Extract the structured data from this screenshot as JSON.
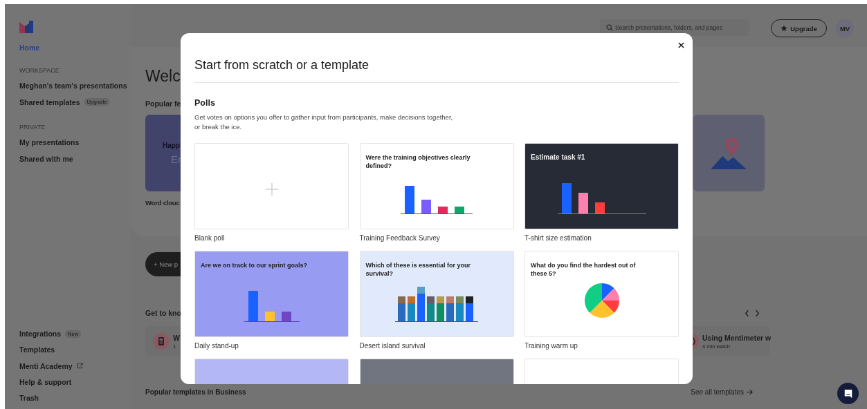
{
  "sidebar": {
    "nav": [
      {
        "label": "Home",
        "selected": true
      }
    ],
    "sections": [
      {
        "heading": "WORKSPACE",
        "items": [
          {
            "label": "Meghan's team's presentations",
            "selected": false
          },
          {
            "label": "Shared templates",
            "badge": "Upgrade",
            "selected": false
          }
        ]
      },
      {
        "heading": "PRIVATE",
        "items": [
          {
            "label": "My presentations",
            "selected": false
          },
          {
            "label": "Shared with me",
            "selected": false
          }
        ]
      }
    ],
    "footer": [
      {
        "label": "Integrations",
        "badge": "New",
        "external": false
      },
      {
        "label": "Templates",
        "external": false
      },
      {
        "label": "Menti Academy",
        "external": true
      },
      {
        "label": "Help & support",
        "external": false
      },
      {
        "label": "Trash",
        "external": false
      }
    ]
  },
  "topbar": {
    "search": {
      "placeholder": "Search presentations, folders, and pages"
    },
    "upgrade": "Upgrade",
    "avatar": "MV"
  },
  "main": {
    "heading": "Welc",
    "popular": "Popular fe",
    "feature_card": {
      "line1": "Happ",
      "line2": "Er"
    },
    "feature_caption": "Word clouc",
    "new_button": "+ New p",
    "get_to_know": "Get to kno",
    "learn_cards": [
      {
        "title": "W",
        "subtitle": "1",
        "kind": "document"
      },
      {
        "title": "Using Mentimeter w",
        "subtitle": "4 min watch",
        "kind": "video"
      }
    ],
    "bottom_heading": "Popular templates in Business",
    "see_all": "See all templates"
  },
  "modal": {
    "title": "Start from scratch or a template",
    "section": {
      "title": "Polls",
      "description": "Get votes on options you offer to gather input from participants, make decisions together, or break the ice."
    },
    "templates": [
      {
        "name": "Blank poll",
        "kind": "blank",
        "color": "#ffffff"
      },
      {
        "name": "Training Feedback Survey",
        "kind": "bars",
        "color": "#ffffff",
        "question": "Were the training objectives clearly defined?"
      },
      {
        "name": "T-shirt size estimation",
        "kind": "bars",
        "color": "#262b36",
        "question": "Estimate task #1"
      },
      {
        "name": "Daily stand-up",
        "kind": "bars",
        "color": "#979cf2",
        "question": "Are we on track to our sprint goals?"
      },
      {
        "name": "Desert island survival",
        "kind": "image-bars",
        "color": "#e1eafc",
        "question": "Which of these is essential for your survival?"
      },
      {
        "name": "Training warm up",
        "kind": "pie",
        "color": "#ffffff",
        "question": "What do you find the hardest out of these 5?"
      },
      {
        "kind": "cut",
        "color": "#b3b7f5"
      },
      {
        "kind": "cut",
        "color": "#70757f"
      },
      {
        "kind": "cut",
        "color": "#ffffff"
      }
    ]
  }
}
